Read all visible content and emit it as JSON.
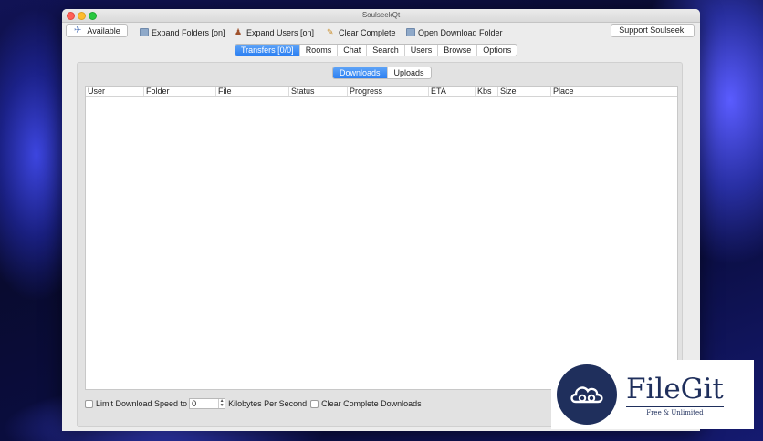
{
  "window": {
    "title": "SoulseekQt"
  },
  "toolbar": {
    "status": "Available",
    "expand_folders": "Expand Folders [on]",
    "expand_users": "Expand Users [on]",
    "clear_complete": "Clear Complete",
    "open_download_folder": "Open Download Folder",
    "support": "Support Soulseek!"
  },
  "tabs": [
    "Transfers [0/0]",
    "Rooms",
    "Chat",
    "Search",
    "Users",
    "Browse",
    "Options"
  ],
  "active_tab": "Transfers [0/0]",
  "subtabs": [
    "Downloads",
    "Uploads"
  ],
  "active_subtab": "Downloads",
  "table": {
    "columns": [
      "User",
      "Folder",
      "File",
      "Status",
      "Progress",
      "ETA",
      "Kbs",
      "Size",
      "Place"
    ],
    "rows": []
  },
  "bottom": {
    "limit_label": "Limit Download Speed to",
    "limit_value": "0",
    "units": "Kilobytes Per Second",
    "clear_label": "Clear Complete Downloads"
  },
  "watermark": {
    "name": "FileGit",
    "tagline": "Free & Unlimited"
  },
  "colors": {
    "accent": "#2c7ff2",
    "watermark": "#1f2f5c"
  }
}
